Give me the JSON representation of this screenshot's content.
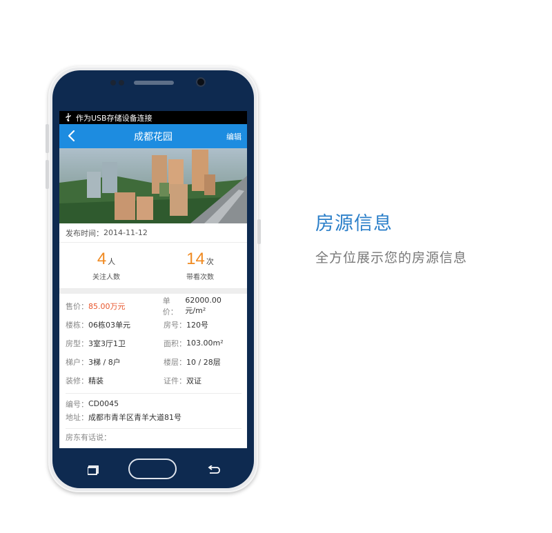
{
  "status_bar": {
    "text": "作为USB存储设备连接",
    "icon": "usb-icon"
  },
  "nav": {
    "title": "成都花园",
    "edit_label": "编辑",
    "back_icon": "chevron-left-icon"
  },
  "publish": {
    "label": "发布时间：",
    "date": "2014-11-12"
  },
  "stats": [
    {
      "value": "4",
      "unit": "人",
      "label": "关注人数"
    },
    {
      "value": "14",
      "unit": "次",
      "label": "带看次数"
    }
  ],
  "details": [
    {
      "left_key": "售价：",
      "left_val": "85.00万元",
      "right_key": "单价：",
      "right_val": "62000.00元/m²"
    },
    {
      "left_key": "楼栋：",
      "left_val": "06栋03单元",
      "right_key": "房号：",
      "right_val": "120号"
    },
    {
      "left_key": "房型：",
      "left_val": "3室3厅1卫",
      "right_key": "面积：",
      "right_val": "103.00m²"
    },
    {
      "left_key": "梯户：",
      "left_val": "3梯 / 8户",
      "right_key": "楼层：",
      "right_val": "10 / 28层"
    },
    {
      "left_key": "装修：",
      "left_val": "精装",
      "right_key": "证件：",
      "right_val": "双证"
    }
  ],
  "info": {
    "code_key": "编号：",
    "code_val": "CD0045",
    "address_key": "地址：",
    "address_val": "成都市青羊区青羊大道81号"
  },
  "landlord_label": "房东有话说：",
  "headline": "房源信息",
  "subline": "全方位展示您的房源信息",
  "colors": {
    "accent": "#1d8ce0",
    "price": "#e8552b",
    "stat": "#f08a21",
    "headline": "#2b7fc9",
    "phone": "#0e2a50"
  }
}
